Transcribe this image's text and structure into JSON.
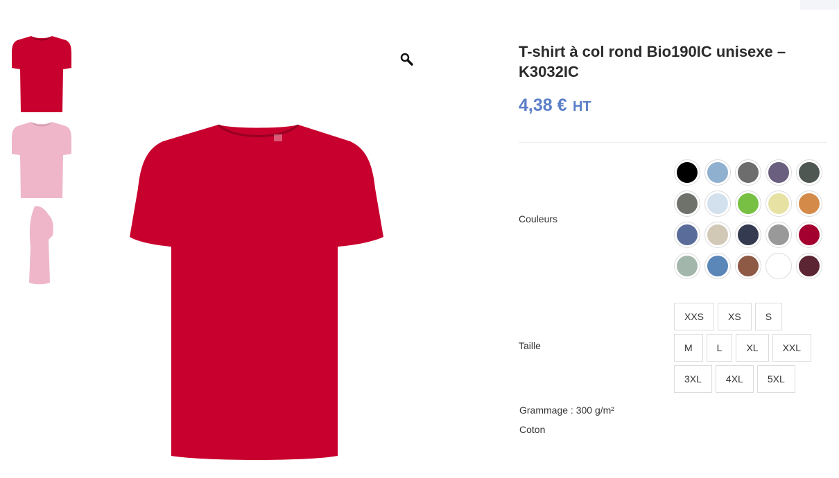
{
  "product": {
    "title": "T-shirt à col rond Bio190IC unisexe – K3032IC",
    "price": "4,38 €",
    "price_suffix": "HT",
    "colors_label": "Couleurs",
    "size_label": "Taille",
    "weight": "Grammage : 300 g/m²",
    "material": "Coton"
  },
  "thumbnails": [
    {
      "name": "red-front",
      "color": "#c8002e"
    },
    {
      "name": "pink-front",
      "color": "#efb6c9"
    },
    {
      "name": "pink-side",
      "color": "#efb6c9"
    }
  ],
  "main_image_color": "#c8002e",
  "colors": [
    "#000000",
    "#8fb0cf",
    "#6d6d6d",
    "#6a5f7e",
    "#4f5752",
    "#6f716b",
    "#d3e1ee",
    "#77c043",
    "#e7e2a3",
    "#d48b4a",
    "#5a6c99",
    "#d2c8b6",
    "#343a50",
    "#999999",
    "#a4002f",
    "#a3b6ab",
    "#5b86b8",
    "#8e5a46",
    "#ffffff",
    "#5b2534"
  ],
  "sizes": [
    "XXS",
    "XS",
    "S",
    "M",
    "L",
    "XL",
    "XXL",
    "3XL",
    "4XL",
    "5XL"
  ]
}
